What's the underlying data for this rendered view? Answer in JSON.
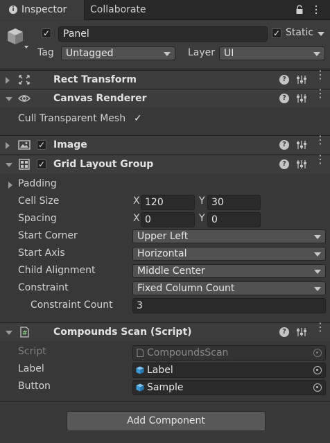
{
  "tabs": {
    "inspector": "Inspector",
    "collaborate": "Collaborate"
  },
  "header": {
    "name": "Panel",
    "static_label": "Static",
    "tag_label": "Tag",
    "tag_value": "Untagged",
    "layer_label": "Layer",
    "layer_value": "UI"
  },
  "components": {
    "rect_transform": {
      "title": "Rect Transform"
    },
    "canvas_renderer": {
      "title": "Canvas Renderer",
      "cull_label": "Cull Transparent Mesh"
    },
    "image": {
      "title": "Image"
    },
    "grid": {
      "title": "Grid Layout Group",
      "padding": "Padding",
      "cell_size": "Cell Size",
      "cell_x": "120",
      "cell_y": "30",
      "spacing": "Spacing",
      "spacing_x": "0",
      "spacing_y": "0",
      "x_label": "X",
      "y_label": "Y",
      "start_corner": "Start Corner",
      "start_corner_value": "Upper Left",
      "start_axis": "Start Axis",
      "start_axis_value": "Horizontal",
      "child_alignment": "Child Alignment",
      "child_alignment_value": "Middle Center",
      "constraint": "Constraint",
      "constraint_value": "Fixed Column Count",
      "constraint_count": "Constraint Count",
      "constraint_count_value": "3"
    },
    "script": {
      "title": "Compounds Scan (Script)",
      "script_label": "Script",
      "script_value": "CompoundsScan",
      "label_label": "Label",
      "label_value": "Label",
      "button_label": "Button",
      "button_value": "Sample"
    }
  },
  "add_component": "Add Component",
  "icons": [
    "info-icon",
    "lock-icon",
    "menu-icon",
    "cube-icon",
    "rect-transform-icon",
    "eye-icon",
    "image-icon",
    "grid-icon",
    "script-icon",
    "help-icon",
    "presets-icon"
  ]
}
